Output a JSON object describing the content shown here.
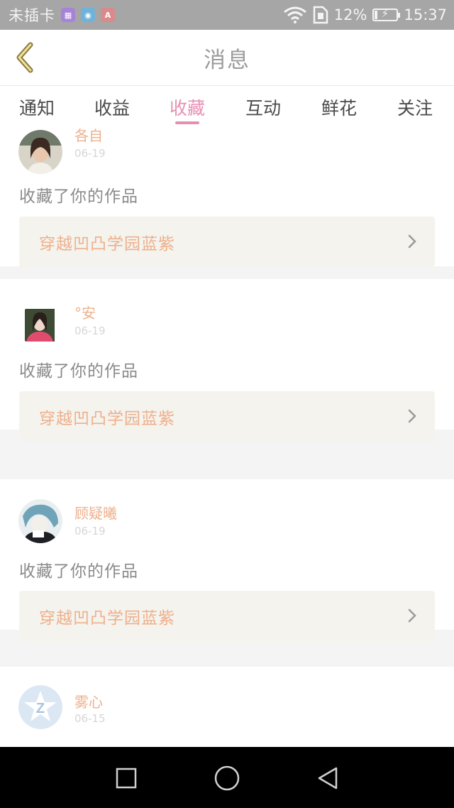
{
  "status_bar": {
    "carrier": "未插卡",
    "battery_percent": "12%",
    "time": "15:37"
  },
  "header": {
    "title": "消息"
  },
  "tabs": [
    {
      "label": "通知",
      "active": false
    },
    {
      "label": "收益",
      "active": false
    },
    {
      "label": "收藏",
      "active": true
    },
    {
      "label": "互动",
      "active": false
    },
    {
      "label": "鲜花",
      "active": false
    },
    {
      "label": "关注",
      "active": false
    }
  ],
  "messages": [
    {
      "username": "各自",
      "date": "06-19",
      "action": "收藏了你的作品",
      "work_title": "穿越凹凸学园蓝紫",
      "avatar": "photo-avatar"
    },
    {
      "username": "°安",
      "date": "06-19",
      "action": "收藏了你的作品",
      "work_title": "穿越凹凸学园蓝紫",
      "avatar": "photo-avatar"
    },
    {
      "username": "顾疑曦",
      "date": "06-19",
      "action": "收藏了你的作品",
      "work_title": "穿越凹凸学园蓝紫",
      "avatar": "anime-avatar"
    },
    {
      "username": "雾心",
      "date": "06-15",
      "action": "",
      "avatar": "default-qq-avatar"
    }
  ],
  "colors": {
    "accent_pink": "#e58fb0",
    "username_orange": "#eeb08c",
    "status_bar_gray": "#a6a6a6"
  },
  "nav_bar": {
    "recent_icon": "square-icon",
    "home_icon": "circle-icon",
    "back_icon": "triangle-back-icon"
  }
}
